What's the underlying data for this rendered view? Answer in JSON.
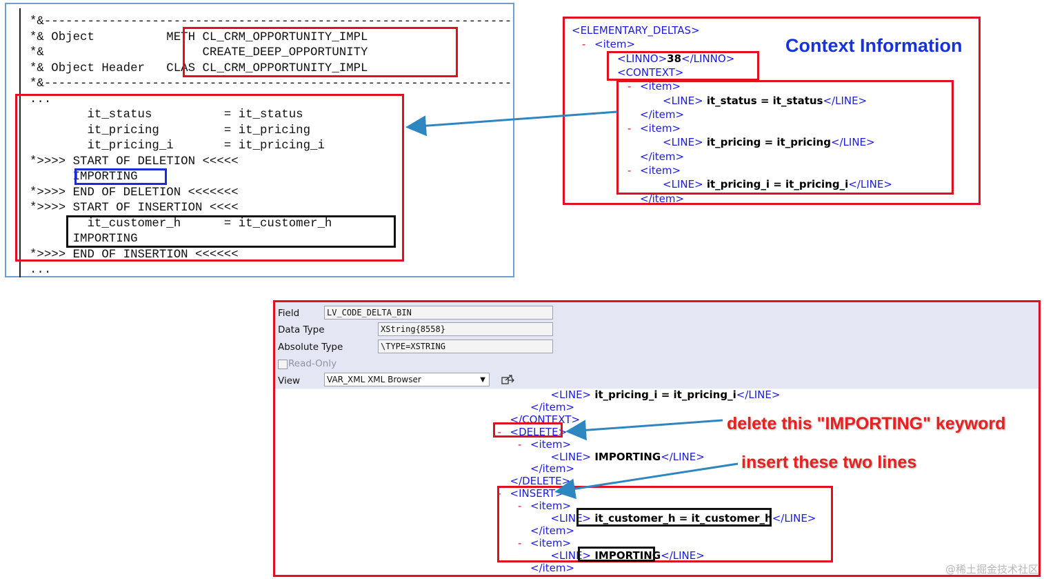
{
  "code_panel": {
    "lines": [
      "*&-----------------------------------------------------------------",
      "*& Object          METH CL_CRM_OPPORTUNITY_IMPL",
      "*&                      CREATE_DEEP_OPPORTUNITY",
      "*& Object Header   CLAS CL_CRM_OPPORTUNITY_IMPL",
      "*&-----------------------------------------------------------------",
      "...",
      "        it_status          = it_status",
      "        it_pricing         = it_pricing",
      "        it_pricing_i       = it_pricing_i",
      "*>>>> START OF DELETION <<<<<",
      "      IMPORTING",
      "*>>>> END OF DELETION <<<<<<<",
      "*>>>> START OF INSERTION <<<<",
      "        it_customer_h      = it_customer_h",
      "      IMPORTING",
      "*>>>> END OF INSERTION <<<<<<",
      "..."
    ]
  },
  "context_panel": {
    "title": "Context Information",
    "lines": [
      {
        "m": "",
        "indent": 0,
        "open": "<ELEMENTARY_DELTAS>",
        "text": "",
        "close": ""
      },
      {
        "m": "-",
        "indent": 1,
        "open": "<item>",
        "text": "",
        "close": ""
      },
      {
        "m": "",
        "indent": 2,
        "open": "<LINNO>",
        "text": "38",
        "close": "</LINNO>"
      },
      {
        "m": "",
        "indent": 2,
        "open": "<CONTEXT>",
        "text": "",
        "close": ""
      },
      {
        "m": "-",
        "indent": 3,
        "open": "<item>",
        "text": "",
        "close": ""
      },
      {
        "m": "",
        "indent": 4,
        "open": "<LINE>",
        "text": " it_status = it_status",
        "close": "</LINE>"
      },
      {
        "m": "",
        "indent": 3,
        "open": "</item>",
        "text": "",
        "close": ""
      },
      {
        "m": "-",
        "indent": 3,
        "open": "<item>",
        "text": "",
        "close": ""
      },
      {
        "m": "",
        "indent": 4,
        "open": "<LINE>",
        "text": " it_pricing = it_pricing",
        "close": "</LINE>"
      },
      {
        "m": "",
        "indent": 3,
        "open": "</item>",
        "text": "",
        "close": ""
      },
      {
        "m": "-",
        "indent": 3,
        "open": "<item>",
        "text": "",
        "close": ""
      },
      {
        "m": "",
        "indent": 4,
        "open": "<LINE>",
        "text": " it_pricing_i = it_pricing_i",
        "close": "</LINE>"
      },
      {
        "m": "",
        "indent": 3,
        "open": "</item>",
        "text": "",
        "close": ""
      }
    ]
  },
  "debugger": {
    "field_label": "Field",
    "field_value": "LV_CODE_DELTA_BIN",
    "datatype_label": "Data Type",
    "datatype_value": "XString{8558}",
    "abstype_label": "Absolute Type",
    "abstype_value": "\\TYPE=XSTRING",
    "readonly_label": "Read-Only",
    "view_label": "View",
    "view_value": "VAR_XML XML Browser",
    "xml_lines": [
      {
        "m": "",
        "indent": 3,
        "open": "<LINE>",
        "text": " it_pricing_i = it_pricing_i",
        "close": "</LINE>"
      },
      {
        "m": "",
        "indent": 2,
        "open": "</item>",
        "text": "",
        "close": ""
      },
      {
        "m": "",
        "indent": 1,
        "open": "</CONTEXT>",
        "text": "",
        "close": ""
      },
      {
        "m": "-",
        "indent": 1,
        "open": "<DELETE>",
        "text": "",
        "close": ""
      },
      {
        "m": "-",
        "indent": 2,
        "open": "<item>",
        "text": "",
        "close": ""
      },
      {
        "m": "",
        "indent": 3,
        "open": "<LINE>",
        "text": " IMPORTING",
        "close": "</LINE>"
      },
      {
        "m": "",
        "indent": 2,
        "open": "</item>",
        "text": "",
        "close": ""
      },
      {
        "m": "",
        "indent": 1,
        "open": "</DELETE>",
        "text": "",
        "close": ""
      },
      {
        "m": "-",
        "indent": 1,
        "open": "<INSERT>",
        "text": "",
        "close": ""
      },
      {
        "m": "-",
        "indent": 2,
        "open": "<item>",
        "text": "",
        "close": ""
      },
      {
        "m": "",
        "indent": 3,
        "open": "<LINE>",
        "text": " it_customer_h = it_customer_h",
        "close": "</LINE>"
      },
      {
        "m": "",
        "indent": 2,
        "open": "</item>",
        "text": "",
        "close": ""
      },
      {
        "m": "-",
        "indent": 2,
        "open": "<item>",
        "text": "",
        "close": ""
      },
      {
        "m": "",
        "indent": 3,
        "open": "<LINE>",
        "text": " IMPORTING",
        "close": "</LINE>"
      },
      {
        "m": "",
        "indent": 2,
        "open": "</item>",
        "text": "",
        "close": ""
      }
    ]
  },
  "annotations": {
    "delete_note": "delete this \"IMPORTING\" keyword",
    "insert_note": "insert these two lines"
  },
  "watermark": "@稀土掘金技术社区",
  "colors": {
    "highlight_red": "#e01020",
    "highlight_blue": "#1c2bd6",
    "arrow_blue": "#2e86c1",
    "xml_tag": "#1a1ae0",
    "annotation_red": "#e82020"
  }
}
